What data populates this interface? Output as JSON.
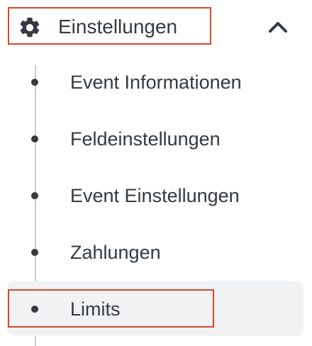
{
  "section": {
    "title": "Einstellungen",
    "icon": "gear-icon",
    "toggle_icon": "chevron-up-icon",
    "expanded": true
  },
  "menu": {
    "items": [
      {
        "label": "Event Informationen",
        "active": false
      },
      {
        "label": "Feldeinstellungen",
        "active": false
      },
      {
        "label": "Event Einstellungen",
        "active": false
      },
      {
        "label": "Zahlungen",
        "active": false
      },
      {
        "label": "Limits",
        "active": true
      }
    ]
  },
  "colors": {
    "text": "#343a40",
    "highlight_border": "#d9472b",
    "active_bg": "#f1f2f4",
    "timeline": "#c8ccd3"
  }
}
